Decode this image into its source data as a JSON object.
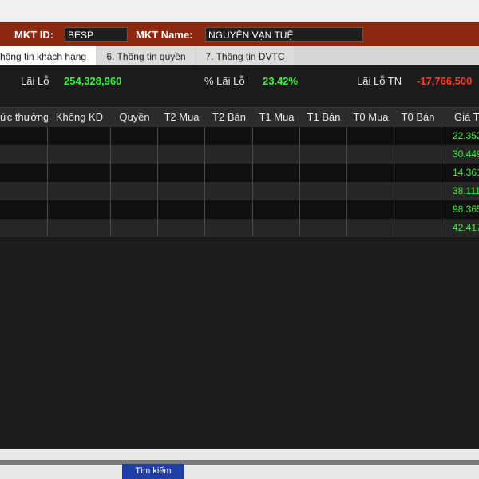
{
  "header": {
    "mkt_id_label": "MKT ID:",
    "mkt_id_value": "BESP",
    "mkt_name_label": "MKT Name:",
    "mkt_name_value": "NGUYỄN VẠN TUỆ"
  },
  "tabs": [
    {
      "label": "hông tin khách hàng"
    },
    {
      "label": "6. Thông tin quyền"
    },
    {
      "label": "7. Thông tin DVTC"
    }
  ],
  "summary": {
    "pnl_label": "Lãi Lỗ",
    "pnl_value": "254,328,960",
    "pnl_pct_label": "% Lãi Lỗ",
    "pnl_pct_value": "23.42%",
    "pnl_tn_label": "Lãi Lỗ TN",
    "pnl_tn_value": "-17,766,500"
  },
  "table": {
    "columns": [
      "ức thưởng",
      "Không KD",
      "Quyền",
      "T2 Mua",
      "T2 Bán",
      "T1 Mua",
      "T1 Bán",
      "T0 Mua",
      "T0 Bán",
      "Giá T"
    ],
    "rows": [
      [
        "",
        "",
        "",
        "",
        "",
        "",
        "",
        "",
        "",
        "22.352"
      ],
      [
        "",
        "",
        "",
        "",
        "",
        "",
        "",
        "",
        "",
        "30.449"
      ],
      [
        "",
        "",
        "",
        "",
        "",
        "",
        "",
        "",
        "",
        "14.361"
      ],
      [
        "",
        "",
        "",
        "",
        "",
        "",
        "",
        "",
        "",
        "38.111"
      ],
      [
        "",
        "",
        "",
        "",
        "",
        "",
        "",
        "",
        "",
        "98.365"
      ],
      [
        "",
        "",
        "",
        "",
        "",
        "",
        "",
        "",
        "",
        "42.417"
      ]
    ]
  },
  "footer": {
    "search_button": "Tìm kiếm"
  }
}
